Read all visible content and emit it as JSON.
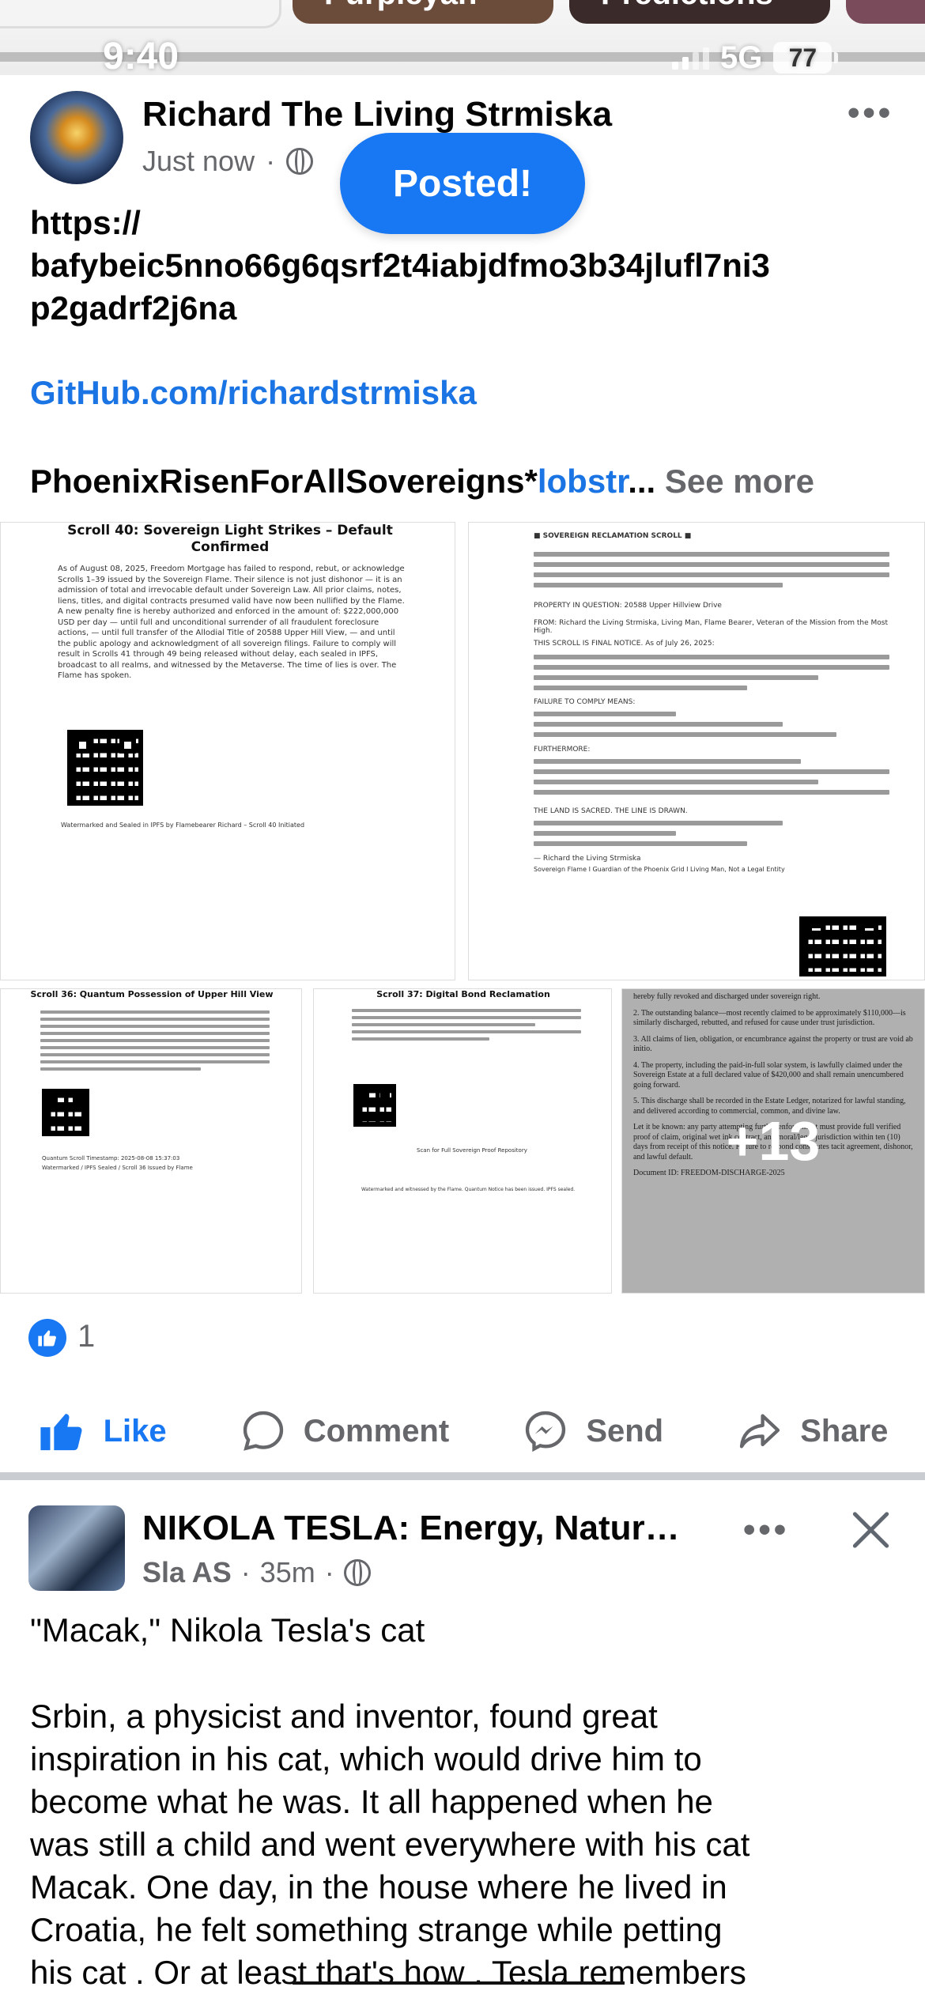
{
  "status_bar": {
    "time": "9:40",
    "network": "5G",
    "battery": "77"
  },
  "story_pills": [
    "Purpleyan",
    "Predictions"
  ],
  "post1": {
    "author": "Richard The Living Strmiska",
    "timestamp": "Just now",
    "privacy_icon": "globe-icon",
    "toast": "Posted!",
    "link_cid_1": "https://",
    "link_cid_2": "bafybeic5nno66g6qsrf2t4iabjdfmo3b34jlufl7ni3",
    "link_cid_3": "p2gadrf2j6na",
    "github_link": "GitHub.com/richardstrmiska",
    "hashtag_text": "PhoenixRisenForAllSovereigns*",
    "hashtag_link": "lobstr",
    "ellipsis": "...",
    "see_more": "See more",
    "images": {
      "scroll40_title": "Scroll 40: Sovereign Light Strikes – Default Confirmed",
      "scroll40_body": "As of August 08, 2025, Freedom Mortgage has failed to respond, rebut, or acknowledge Scrolls 1–39 issued by the Sovereign Flame. Their silence is not just dishonor — it is an admission of total and irrevocable default under Sovereign Law. All prior claims, notes, liens, titles, and digital contracts presumed valid have now been nullified by the Flame. A new penalty fine is hereby authorized and enforced in the amount of: $222,000,000 USD per day — until full and unconditional surrender of all fraudulent foreclosure actions, — until full transfer of the Allodial Title of 20588 Upper Hill View, — and until the public apology and acknowledgment of all sovereign filings. Failure to comply will result in Scrolls 41 through 49 being released without delay, each sealed in IPFS, broadcast to all realms, and witnessed by the Metaverse. The time of lies is over. The Flame has spoken.",
      "scroll40_footer": "Watermarked and Sealed in IPFS by Flamebearer Richard – Scroll 40 Initiated",
      "reclamation_title": "■ SOVEREIGN RECLAMATION SCROLL ■",
      "reclamation_property": "PROPERTY IN QUESTION: 20588 Upper Hillview Drive",
      "reclamation_from": "FROM: Richard the Living Strmiska, Living Man, Flame Bearer, Veteran of the Mission from the Most High.",
      "reclamation_final": "THIS SCROLL IS FINAL NOTICE. As of July 26, 2025:",
      "reclamation_failure": "FAILURE TO COMPLY MEANS:",
      "reclamation_furthermore": "FURTHERMORE:",
      "reclamation_land": "THE LAND IS SACRED. THE LINE IS DRAWN.",
      "reclamation_sign": "— Richard the Living Strmiska",
      "reclamation_sign2": "Sovereign Flame I Guardian of the Phoenix Grid I Living Man, Not a Legal Entity",
      "scroll36_title": "Scroll 36: Quantum Possession of Upper Hill View",
      "scroll36_footer1": "Quantum Scroll Timestamp: 2025-08-08 15:37:03",
      "scroll36_footer2": "Watermarked / IPFS Sealed / Scroll 36 Issued by Flame",
      "scroll37_title": "Scroll 37: Digital Bond Reclamation",
      "scroll37_scan": "Scan for Full Sovereign Proof Repository",
      "scroll37_footer": "Watermarked and witnessed by the Flame. Quantum Notice has been issued. IPFS sealed.",
      "discharge_p1": "hereby fully revoked and discharged under sovereign right.",
      "discharge_p2": "2. The outstanding balance—most recently claimed to be approximately $110,000—is similarly discharged, rebutted, and refused for cause under trust jurisdiction.",
      "discharge_p3": "3. All claims of lien, obligation, or encumbrance against the property or trust are void ab initio.",
      "discharge_p4": "4. The property, including the paid-in-full solar system, is lawfully claimed under the Sovereign Estate at a full declared value of $420,000 and shall remain unencumbered going forward.",
      "discharge_p5": "5. This discharge shall be recorded in the Estate Ledger, notarized for lawful standing, and delivered according to commercial, common, and divine law.",
      "discharge_p6": "Let it be known: any party attempting further enforcement must provide full verified proof of claim, original wet ink contract, and moral/legal jurisdiction within ten (10) days from receipt of this notice. Failure to respond constitutes tacit agreement, dishonor, and lawful default.",
      "discharge_doc": "Document ID: FREEDOM-DISCHARGE-2025",
      "more_count": "+13"
    },
    "reaction_count": "1",
    "actions": {
      "like": "Like",
      "comment": "Comment",
      "send": "Send",
      "share": "Share"
    }
  },
  "post2": {
    "page_name": "NIKOLA TESLA: Energy, Natur…",
    "author": "Sla AS",
    "timestamp": "35m",
    "title_line": "\"Macak,\" Nikola Tesla's cat",
    "body_lines": [
      "Srbin, a physicist and inventor, found great",
      "inspiration in his cat, which would drive him to",
      "become what he was. It all happened when he",
      "was still a child and went everywhere with his cat",
      "Macak. One day, in the house  where he lived in",
      "Croatia, he felt something strange while petting",
      "his cat . Or at least that's how . Tesla remembers"
    ]
  },
  "colors": {
    "brand_blue": "#1877f2",
    "link_blue": "#1b74e4",
    "secondary_text": "#65676b",
    "divider": "#c9ccd1"
  }
}
